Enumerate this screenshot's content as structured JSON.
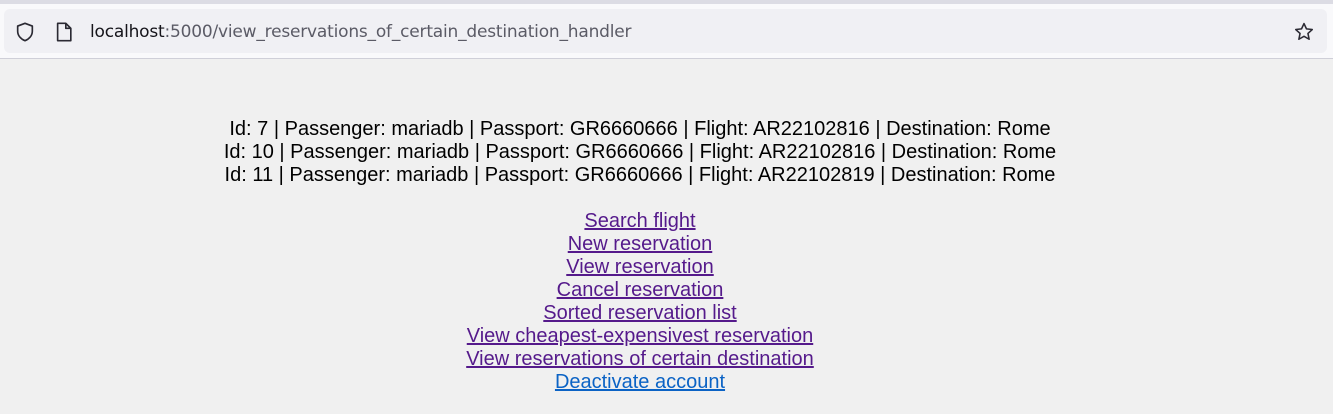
{
  "browser": {
    "url_host": "localhost",
    "url_path": ":5000/view_reservations_of_certain_destination_handler",
    "icons": [
      "shield-icon",
      "page-icon",
      "star-icon"
    ]
  },
  "reservations": [
    "Id: 7 | Passenger: mariadb | Passport: GR6660666 | Flight: AR22102816 | Destination: Rome",
    "Id: 10 | Passenger: mariadb | Passport: GR6660666 | Flight: AR22102816 | Destination: Rome",
    "Id: 11 | Passenger: mariadb | Passport: GR6660666 | Flight: AR22102819 | Destination: Rome"
  ],
  "links": [
    "Search flight",
    "New reservation",
    "View reservation",
    "Cancel reservation",
    "Sorted reservation list",
    "View cheapest-expensivest reservation",
    "View reservations of certain destination",
    "Deactivate account"
  ],
  "colors": {
    "visited_link": "#551a8b",
    "unvisited_link": "#0b63c5",
    "page_background": "#f0f0f0"
  }
}
